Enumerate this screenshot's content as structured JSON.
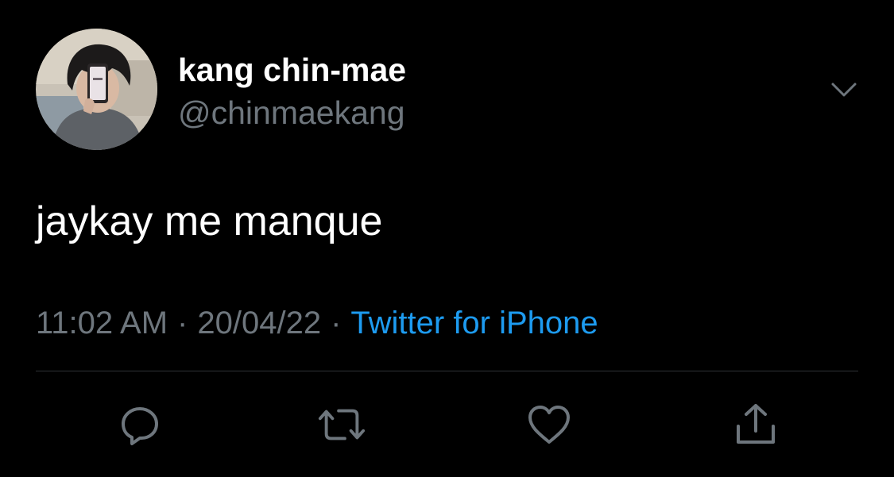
{
  "tweet": {
    "author": {
      "display_name": "kang chin-mae",
      "handle": "@chinmaekang",
      "avatar_icon": "profile-photo-mirror-selfie"
    },
    "text": "jaykay me manque",
    "time": "11:02 AM",
    "separator": "·",
    "date": "20/04/22",
    "source": "Twitter for iPhone",
    "menu_icon": "chevron-down-icon"
  },
  "actions": [
    {
      "icon": "reply-icon"
    },
    {
      "icon": "retweet-icon"
    },
    {
      "icon": "like-icon"
    },
    {
      "icon": "share-icon"
    }
  ],
  "colors": {
    "background": "#000000",
    "primary_text": "#ffffff",
    "secondary_text": "#6e767d",
    "link": "#1d9bf0",
    "divider": "#2f3336"
  }
}
